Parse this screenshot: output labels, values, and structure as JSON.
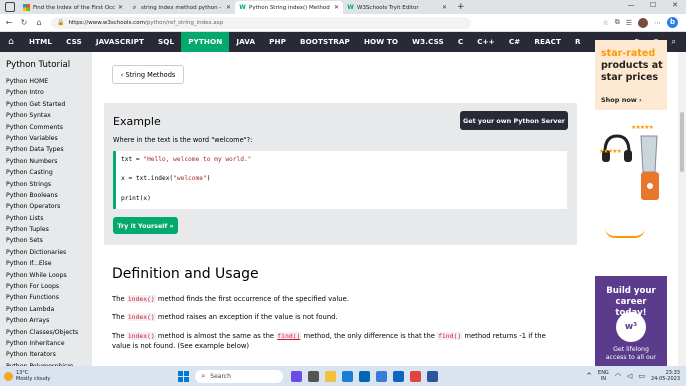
{
  "browser": {
    "tabs": [
      {
        "label": "Find the Index of the First Occurr",
        "icon": "ms"
      },
      {
        "label": "string index method python - Se",
        "icon": "search"
      },
      {
        "label": "Python String index() Method",
        "icon": "w3"
      },
      {
        "label": "W3Schools Tryit Editor",
        "icon": "w3"
      }
    ],
    "url_host": "https://www.w3schools.com",
    "url_path": "/python/ref_string_index.asp"
  },
  "nav": {
    "items": [
      "HTML",
      "CSS",
      "JAVASCRIPT",
      "SQL",
      "PYTHON",
      "JAVA",
      "PHP",
      "BOOTSTRAP",
      "HOW TO",
      "W3.CSS",
      "C",
      "C++",
      "C#",
      "REACT",
      "R"
    ],
    "active_index": 4
  },
  "sidebar": {
    "heading": "Python Tutorial",
    "items": [
      "Python HOME",
      "Python Intro",
      "Python Get Started",
      "Python Syntax",
      "Python Comments",
      "Python Variables",
      "Python Data Types",
      "Python Numbers",
      "Python Casting",
      "Python Strings",
      "Python Booleans",
      "Python Operators",
      "Python Lists",
      "Python Tuples",
      "Python Sets",
      "Python Dictionaries",
      "Python If...Else",
      "Python While Loops",
      "Python For Loops",
      "Python Functions",
      "Python Lambda",
      "Python Arrays",
      "Python Classes/Objects",
      "Python Inheritance",
      "Python Iterators",
      "Python Polymorphism"
    ]
  },
  "main": {
    "back_label": "‹ String Methods",
    "example": {
      "title": "Example",
      "server_button": "Get your own Python Server",
      "question": "Where in the text is the word \"welcome\"?:",
      "code": {
        "line1_a": "txt = ",
        "line1_str": "\"Hello, welcome to my world.\"",
        "line2_a": "x = txt.index(",
        "line2_str": "\"welcome\"",
        "line2_b": ")",
        "line3": "print(x)"
      },
      "try_button": "Try it Yourself »"
    },
    "definition_heading": "Definition and Usage",
    "p1_a": "The ",
    "p1_kw": "index()",
    "p1_b": " method finds the first occurrence of the specified value.",
    "p2_a": "The ",
    "p2_kw": "index()",
    "p2_b": " method raises an exception if the value is not found.",
    "p3_a": "The ",
    "p3_kw1": "index()",
    "p3_b": " method is almost the same as the ",
    "p3_kw2": "find()",
    "p3_c": " method, the only difference is that the ",
    "p3_kw3": "find()",
    "p3_d": " method returns -1 if the value is not found. (See example below)"
  },
  "ads": {
    "amazon_line1": "star-rated",
    "amazon_line2": "products at",
    "amazon_line3": "star prices",
    "amazon_shop": "Shop now ›",
    "w3_line1": "Build your",
    "w3_line2": "career today!",
    "w3_logo": "w³",
    "w3_line3": "Get lifelong",
    "w3_line4": "access to all our"
  },
  "taskbar": {
    "temp": "13°C",
    "weather": "Mostly cloudy",
    "search_placeholder": "Search",
    "lang1": "ENG",
    "lang2": "IN",
    "time": "23:33",
    "date": "24-05-2023"
  },
  "colors": {
    "w3_green": "#04aa6d",
    "nav_dark": "#282a35",
    "sidebar_bg": "#e7e9eb",
    "keyword_red": "#dc143c"
  }
}
